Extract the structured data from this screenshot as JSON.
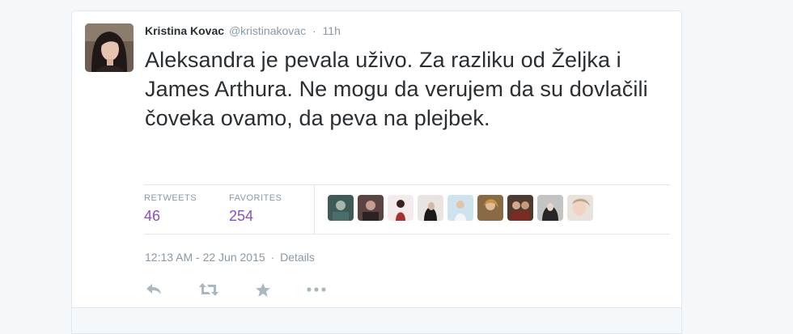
{
  "tweet": {
    "fullname": "Kristina Kovac",
    "username": "@kristinakovac",
    "separator": "·",
    "time_ago": "11h",
    "text": "Aleksandra je pevala uživo. Za razliku od Željka i James Arthura. Ne mogu da verujem da su dovlačili čoveka ovamo, da peva na plejbek.",
    "retweets_label": "RETWEETS",
    "retweets_count": "46",
    "favorites_label": "FAVORITES",
    "favorites_count": "254",
    "timestamp": "12:13 AM - 22 Jun 2015",
    "details_separator": "·",
    "details_label": "Details"
  },
  "colors": {
    "accent_purple": "#8b4fc2",
    "muted_text": "#8899a6",
    "body_text": "#292f33",
    "border": "#e1e8ed",
    "background": "#f5f8fa"
  },
  "icons": {
    "avatar": "profile-photo",
    "favoriters": [
      "avatar-photo-1",
      "avatar-photo-2",
      "avatar-photo-3",
      "avatar-photo-4",
      "avatar-photo-5",
      "avatar-photo-6",
      "avatar-photo-7",
      "avatar-photo-8",
      "avatar-photo-9"
    ],
    "actions": [
      "reply-icon",
      "retweet-icon",
      "favorite-star-icon",
      "more-dots-icon"
    ]
  }
}
